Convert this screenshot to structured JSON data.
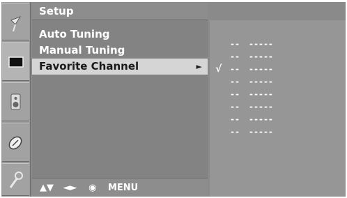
{
  "menu": {
    "title": "Setup",
    "items": [
      {
        "label": "Auto Tuning"
      },
      {
        "label": "Manual Tuning"
      },
      {
        "label": "Favorite Channel",
        "arrow": "►"
      }
    ]
  },
  "footer": {
    "arrows_ud": "▲▼",
    "arrows_lr": "◄►",
    "ok": "◉",
    "menu": "MENU"
  },
  "favorites": {
    "check": "√",
    "rows": [
      {
        "num": "--",
        "name": "-----"
      },
      {
        "num": "--",
        "name": "-----"
      },
      {
        "num": "--",
        "name": "-----"
      },
      {
        "num": "--",
        "name": "-----"
      },
      {
        "num": "--",
        "name": "-----"
      },
      {
        "num": "--",
        "name": "-----"
      },
      {
        "num": "--",
        "name": "-----"
      },
      {
        "num": "--",
        "name": "-----"
      }
    ]
  },
  "colors": {
    "panel": "#838383",
    "highlight": "#d5d5d5",
    "text": "#ffffff"
  },
  "icons": [
    "antenna-icon",
    "screen-icon",
    "speaker-icon",
    "clock-icon",
    "settings-key-icon"
  ]
}
